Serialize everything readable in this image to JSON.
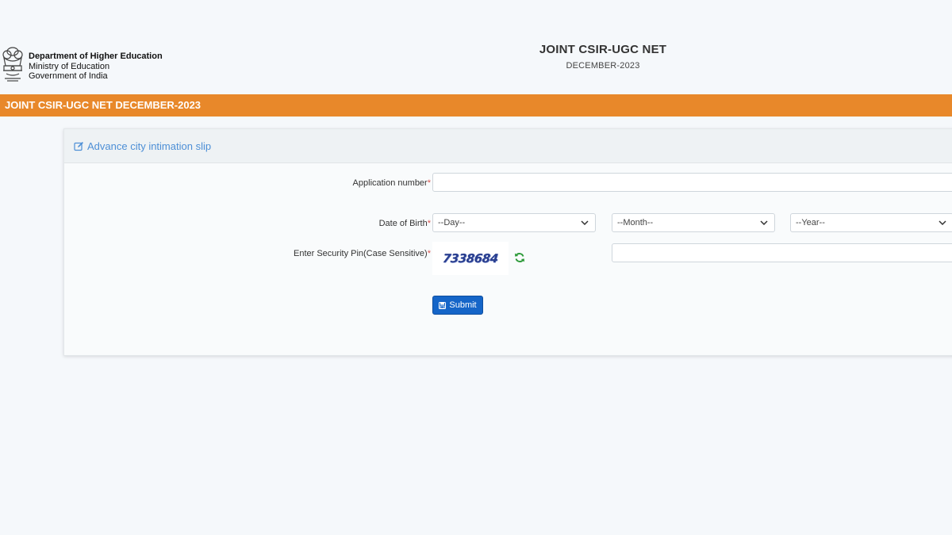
{
  "header": {
    "org_line1": "Department of Higher Education",
    "org_line2": "Ministry of Education",
    "org_line3": "Government of India",
    "title": "JOINT CSIR-UGC NET",
    "subtitle": "DECEMBER-2023"
  },
  "banner": {
    "text": "JOINT CSIR-UGC NET DECEMBER-2023",
    "color": "#e8882a"
  },
  "panel": {
    "heading": "Advance city intimation slip",
    "heading_icon": "edit-icon",
    "heading_color": "#4d8fd6"
  },
  "form": {
    "application_label": "Application number",
    "application_value": "",
    "dob_label": "Date of Birth",
    "day_selected": "--Day--",
    "month_selected": "--Month--",
    "year_selected": "--Year--",
    "pin_label": "Enter Security Pin(Case Sensitive)",
    "captcha_text": "7338684",
    "pin_value": "",
    "required_mark": "*",
    "required_color": "#d9534f",
    "refresh_icon": "refresh-icon",
    "refresh_color": "#2e9b3a",
    "submit_label": "Submit",
    "submit_icon": "save-icon",
    "submit_color": "#1565c8"
  }
}
